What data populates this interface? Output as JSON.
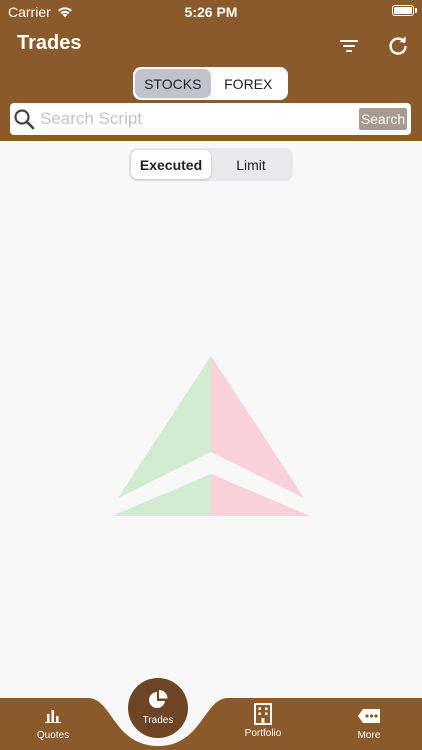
{
  "status_bar": {
    "carrier": "Carrier",
    "time": "5:26 PM"
  },
  "nav": {
    "title": "Trades",
    "filter_icon": "filter-icon",
    "refresh_icon": "refresh-icon"
  },
  "market_segment": {
    "items": [
      "STOCKS",
      "FOREX"
    ],
    "selected": "STOCKS"
  },
  "search": {
    "placeholder": "Search Script",
    "button_label": "Search"
  },
  "trade_segment": {
    "items": [
      "Executed",
      "Limit"
    ],
    "selected": "Executed"
  },
  "tab_bar": {
    "items": [
      {
        "label": "Quotes",
        "icon": "bar-chart-icon"
      },
      {
        "label": "Trades",
        "icon": "pie-chart-icon"
      },
      {
        "label": "Portfolio",
        "icon": "building-icon"
      },
      {
        "label": "More",
        "icon": "ellipsis-tag-icon"
      }
    ],
    "selected": "Trades"
  },
  "colors": {
    "brand_brown": "#8b5a2b",
    "tab_center": "#6e4524",
    "logo_green": "#d2ecd2",
    "logo_pink": "#f9d1d9"
  }
}
